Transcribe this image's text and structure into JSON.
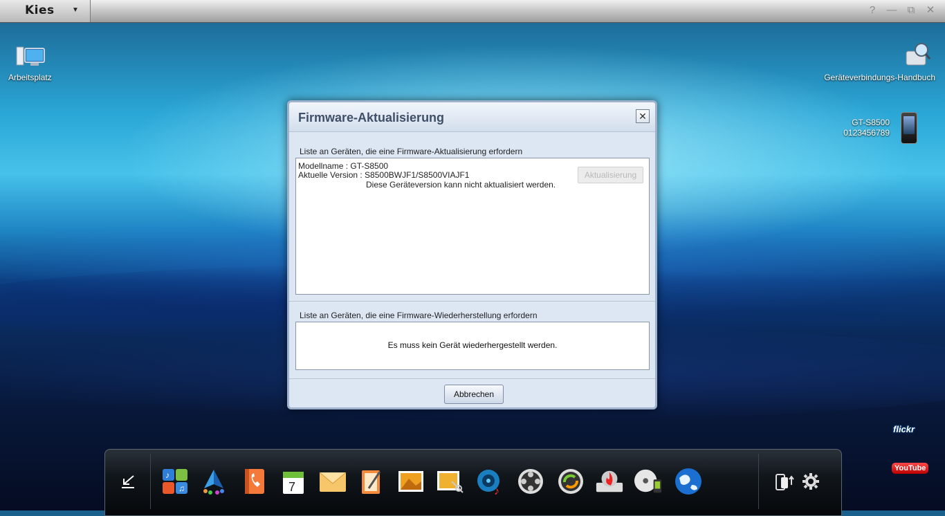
{
  "app": {
    "name": "Kies",
    "menu_caret": "▼"
  },
  "window_controls": {
    "help": "?",
    "minimize": "—",
    "restore": "⧉",
    "close": "✕"
  },
  "desktop": {
    "my_computer": "Arbeitsplatz",
    "connection_manual": "Geräteverbindungs-Handbuch",
    "device_model": "GT-S8500",
    "device_number": "0123456789"
  },
  "dialog": {
    "title": "Firmware-Aktualisierung",
    "close_glyph": "✕",
    "update_section_label": "Liste an Geräten, die eine Firmware-Aktualisierung erfordern",
    "model_line": "Modellname : GT-S8500",
    "version_line": "Aktuelle Version : S8500BWJF1/S8500VIAJF1",
    "status_line": "Diese Geräteversion kann nicht aktualisiert werden.",
    "update_button": "Aktualisierung",
    "restore_section_label": "Liste an Geräten, die eine Firmware-Wiederherstellung erfordern",
    "restore_message": "Es muss kein Gerät wiederhergestellt werden.",
    "cancel_button": "Abbrechen"
  },
  "dock": {
    "calendar_day": "7",
    "icons": [
      "back-icon",
      "music-apps-icon",
      "navigation-icon",
      "phonebook-icon",
      "calendar-icon",
      "message-icon",
      "memo-icon",
      "photo-icon",
      "photo-edit-icon",
      "music-icon",
      "video-icon",
      "sync-icon",
      "burn-icon",
      "dvd-icon",
      "internet-icon",
      "phone-transfer-icon",
      "settings-icon"
    ]
  },
  "social": {
    "flickr": "flickr",
    "youtube": "YouTube"
  },
  "colors": {
    "accent": "#3f4f68",
    "dialog_bg": "#dde6f3"
  }
}
